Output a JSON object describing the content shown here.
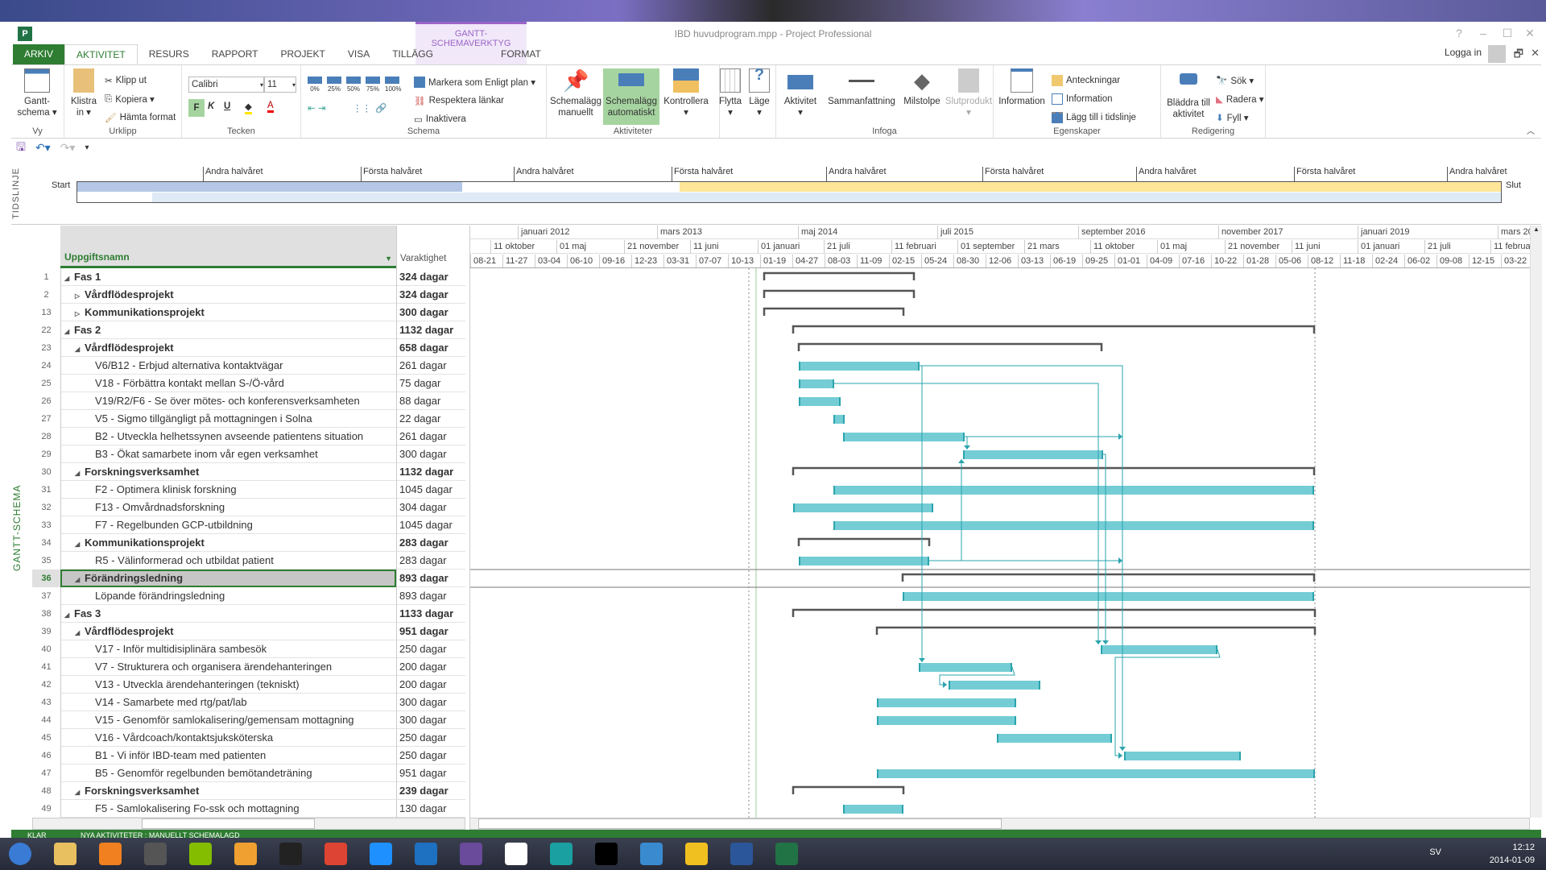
{
  "window": {
    "title": "IBD huvudprogram.mpp - Project Professional",
    "context_tab": "GANTT-SCHEMAVERKTYG",
    "login": "Logga in",
    "help": "?",
    "minimize": "–",
    "maximize": "☐",
    "close": "✕",
    "restore": "🗗"
  },
  "tabs": [
    "ARKIV",
    "AKTIVITET",
    "RESURS",
    "RAPPORT",
    "PROJEKT",
    "VISA",
    "TILLÄGG",
    "FORMAT"
  ],
  "active_tab": "AKTIVITET",
  "ribbon": {
    "vy": {
      "label": "Vy",
      "gantt": "Gantt-\nschema ▾"
    },
    "urklipp": {
      "label": "Urklipp",
      "paste": "Klistra\nin ▾",
      "cut": "Klipp ut",
      "copy": "Kopiera ▾",
      "format_painter": "Hämta format"
    },
    "tecken": {
      "label": "Tecken",
      "font": "Calibri",
      "size": "11",
      "bold": "F",
      "italic": "K",
      "underline": "U"
    },
    "schema": {
      "label": "Schema",
      "pct": [
        "0%",
        "25%",
        "50%",
        "75%",
        "100%"
      ],
      "mark_on_track": "Markera som Enligt plan ▾",
      "respect_links": "Respektera länkar",
      "inactivate": "Inaktivera"
    },
    "aktiviteter": {
      "label": "Aktiviteter",
      "manual": "Schemalägg\nmanuellt",
      "auto": "Schemalägg\nautomatiskt",
      "inspect": "Kontrollera\n▾",
      "move": "Flytta\n▾",
      "mode": "Läge\n▾"
    },
    "infoga": {
      "label": "Infoga",
      "task": "Aktivitet\n▾",
      "summary": "Sammanfattning",
      "milestone": "Milstolpe",
      "deliverable": "Slutprodukt\n▾"
    },
    "egenskaper": {
      "label": "Egenskaper",
      "information": "Information",
      "notes": "Anteckningar",
      "details": "Information",
      "add_timeline": "Lägg till i tidslinje"
    },
    "redigering": {
      "label": "Redigering",
      "scroll_to": "Bläddra till\naktivitet",
      "find": "Sök ▾",
      "clear": "Radera ▾",
      "fill": "Fyll ▾"
    }
  },
  "timeline": {
    "side_label": "TIDSLINJE",
    "start": "Start",
    "end": "Slut",
    "labels": [
      "Andra halvåret",
      "Första halvåret",
      "Andra halvåret",
      "Första halvåret",
      "Andra halvåret",
      "Första halvåret",
      "Andra halvåret",
      "Första halvåret",
      "Andra halvåret"
    ],
    "colors": {
      "blue": "#b4c7e7",
      "yellow": "#ffe699",
      "light": "#deeaf6"
    }
  },
  "view_label": "GANTT-SCHEMA",
  "columns": {
    "name": "Uppgiftsnamn",
    "duration": "Varaktighet"
  },
  "timescale": {
    "top": [
      "januari 2012",
      "mars 2013",
      "maj 2014",
      "juli 2015",
      "september 2016",
      "november 2017",
      "januari 2019",
      "mars 20"
    ],
    "middle": [
      "11 oktober",
      "01 maj",
      "21 november",
      "11 juni",
      "01 januari",
      "21 juli",
      "11 februari",
      "01 september",
      "21 mars",
      "11 oktober",
      "01 maj",
      "21 november",
      "11 juni",
      "01 januari",
      "21 juli",
      "11 februa"
    ],
    "bottom": [
      "08-21",
      "11-27",
      "03-04",
      "06-10",
      "09-16",
      "12-23",
      "03-31",
      "07-07",
      "10-13",
      "01-19",
      "04-27",
      "08-03",
      "11-09",
      "02-15",
      "05-24",
      "08-30",
      "12-06",
      "03-13",
      "06-19",
      "09-25",
      "01-01",
      "04-09",
      "07-16",
      "10-22",
      "01-28",
      "05-06",
      "08-12",
      "11-18",
      "02-24",
      "06-02",
      "09-08",
      "12-15",
      "03-22"
    ]
  },
  "tasks": [
    {
      "id": "1",
      "name": "Fas 1",
      "duration": "324 dagar",
      "level": 0,
      "summary": true,
      "expander": "expanded"
    },
    {
      "id": "2",
      "name": "Vårdflödesprojekt",
      "duration": "324 dagar",
      "level": 1,
      "summary": true,
      "expander": "collapsed"
    },
    {
      "id": "13",
      "name": "Kommunikationsprojekt",
      "duration": "300 dagar",
      "level": 1,
      "summary": true,
      "expander": "collapsed"
    },
    {
      "id": "22",
      "name": "Fas 2",
      "duration": "1132 dagar",
      "level": 0,
      "summary": true,
      "expander": "expanded"
    },
    {
      "id": "23",
      "name": "Vårdflödesprojekt",
      "duration": "658 dagar",
      "level": 1,
      "summary": true,
      "expander": "expanded"
    },
    {
      "id": "24",
      "name": "V6/B12 - Erbjud alternativa kontaktvägar",
      "duration": "261 dagar",
      "level": 2
    },
    {
      "id": "25",
      "name": "V18 - Förbättra kontakt mellan S-/Ö-vård",
      "duration": "75 dagar",
      "level": 2
    },
    {
      "id": "26",
      "name": "V19/R2/F6 - Se över mötes- och konferensverksamheten",
      "duration": "88 dagar",
      "level": 2
    },
    {
      "id": "27",
      "name": "V5 - Sigmo tillgängligt på mottagningen i Solna",
      "duration": "22 dagar",
      "level": 2
    },
    {
      "id": "28",
      "name": "B2 - Utveckla helhetssynen avseende patientens situation",
      "duration": "261 dagar",
      "level": 2
    },
    {
      "id": "29",
      "name": "B3 - Ökat samarbete inom vår egen verksamhet",
      "duration": "300 dagar",
      "level": 2
    },
    {
      "id": "30",
      "name": "Forskningsverksamhet",
      "duration": "1132 dagar",
      "level": 1,
      "summary": true,
      "expander": "expanded"
    },
    {
      "id": "31",
      "name": "F2 - Optimera klinisk forskning",
      "duration": "1045 dagar",
      "level": 2
    },
    {
      "id": "32",
      "name": "F13 - Omvårdnadsforskning",
      "duration": "304 dagar",
      "level": 2
    },
    {
      "id": "33",
      "name": "F7 - Regelbunden GCP-utbildning",
      "duration": "1045 dagar",
      "level": 2
    },
    {
      "id": "34",
      "name": "Kommunikationsprojekt",
      "duration": "283 dagar",
      "level": 1,
      "summary": true,
      "expander": "expanded"
    },
    {
      "id": "35",
      "name": "R5 - Välinformerad och utbildat patient",
      "duration": "283 dagar",
      "level": 2
    },
    {
      "id": "36",
      "name": "Förändringsledning",
      "duration": "893 dagar",
      "level": 1,
      "summary": true,
      "expander": "expanded",
      "selected": true
    },
    {
      "id": "37",
      "name": "Löpande förändringsledning",
      "duration": "893 dagar",
      "level": 2
    },
    {
      "id": "38",
      "name": "Fas 3",
      "duration": "1133 dagar",
      "level": 0,
      "summary": true,
      "expander": "expanded"
    },
    {
      "id": "39",
      "name": "Vårdflödesprojekt",
      "duration": "951 dagar",
      "level": 1,
      "summary": true,
      "expander": "expanded"
    },
    {
      "id": "40",
      "name": "V17 - Inför multidisiplinära sambesök",
      "duration": "250 dagar",
      "level": 2
    },
    {
      "id": "41",
      "name": "V7 - Strukturera och organisera ärendehanteringen",
      "duration": "200 dagar",
      "level": 2
    },
    {
      "id": "42",
      "name": "V13 - Utveckla ärendehanteringen (tekniskt)",
      "duration": "200 dagar",
      "level": 2
    },
    {
      "id": "43",
      "name": "V14 - Samarbete med rtg/pat/lab",
      "duration": "300 dagar",
      "level": 2
    },
    {
      "id": "44",
      "name": "V15 - Genomför samlokalisering/gemensam mottagning",
      "duration": "300 dagar",
      "level": 2
    },
    {
      "id": "45",
      "name": "V16 - Vårdcoach/kontaktsjuksköterska",
      "duration": "250 dagar",
      "level": 2
    },
    {
      "id": "46",
      "name": "B1 - Vi inför IBD-team med patienten",
      "duration": "250 dagar",
      "level": 2
    },
    {
      "id": "47",
      "name": "B5 - Genomför regelbunden bemötandeträning",
      "duration": "951 dagar",
      "level": 2
    },
    {
      "id": "48",
      "name": "Forskningsverksamhet",
      "duration": "239 dagar",
      "level": 1,
      "summary": true,
      "expander": "expanded"
    },
    {
      "id": "49",
      "name": "F5 - Samlokalisering Fo-ssk och mottagning",
      "duration": "130 dagar",
      "level": 2
    }
  ],
  "colors": {
    "task_bar": "#74cdd5",
    "task_bar_edge": "#2aa4ad",
    "summary_bar": "#555555",
    "link": "#2aa4ad",
    "accent": "#2e7d32",
    "context": "#9b64c8"
  },
  "status": {
    "ready": "KLAR",
    "new_tasks": "NYA AKTIVITETER : MANUELLT SCHEMALAGD"
  },
  "taskbar": {
    "apps": [
      "start-button",
      "file-explorer",
      "media-player",
      "vaio",
      "spotify",
      "outlook",
      "foxit",
      "chrome",
      "internet-explorer",
      "lync",
      "app-purple",
      "wf",
      "app-teal",
      "app-spiral",
      "itunes",
      "skype",
      "word",
      "project"
    ],
    "language": "SV",
    "time": "12:12",
    "date": "2014-01-09"
  }
}
